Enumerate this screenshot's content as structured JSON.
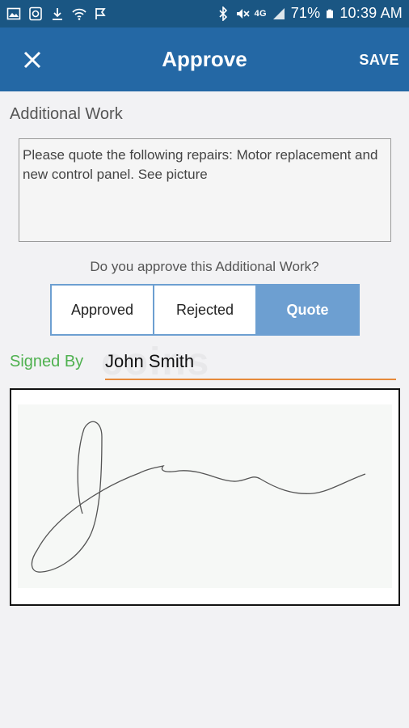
{
  "status_bar": {
    "battery": "71%",
    "time": "10:39 AM",
    "network": "4G"
  },
  "app_bar": {
    "title": "Approve",
    "save_label": "SAVE"
  },
  "form": {
    "section_label": "Additional Work",
    "description": "Please quote the following repairs: Motor replacement and new control panel. See picture",
    "question": "Do you approve this Additional Work?",
    "options": [
      {
        "label": "Approved",
        "selected": false
      },
      {
        "label": "Rejected",
        "selected": false
      },
      {
        "label": "Quote",
        "selected": true
      }
    ],
    "signed_by_label": "Signed By",
    "signed_by_value": "John Smith",
    "watermark": "coins"
  },
  "colors": {
    "status_bar": "#1a5683",
    "app_bar": "#2468a5",
    "segment_accent": "#6d9fd1",
    "signed_label": "#4fb14f",
    "input_underline": "#e68a3b"
  }
}
